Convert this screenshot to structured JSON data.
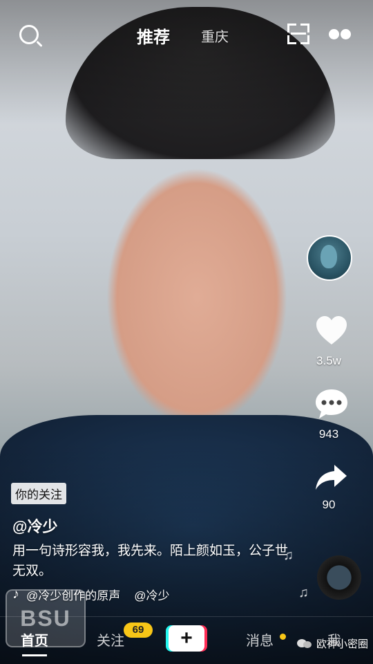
{
  "top_tabs": {
    "recommend": "推荐",
    "city": "重庆"
  },
  "rail": {
    "likes": "3.5w",
    "comments": "943",
    "shares": "90"
  },
  "video": {
    "follow_badge": "你的关注",
    "author": "@冷少",
    "caption": "用一句诗形容我，我先来。陌上颜如玉，公子世无双。",
    "music": "@冷少创作的原声",
    "music_repeat": "@冷少"
  },
  "nav": {
    "home": "首页",
    "follow": "关注",
    "follow_badge": "69",
    "plus": "+",
    "messages": "消息",
    "me": "我"
  },
  "watermark": "欧神小密圈",
  "colors": {
    "badge_yellow": "#f8c617",
    "plus_cyan": "#24f6f0",
    "plus_red": "#fe2c55"
  }
}
